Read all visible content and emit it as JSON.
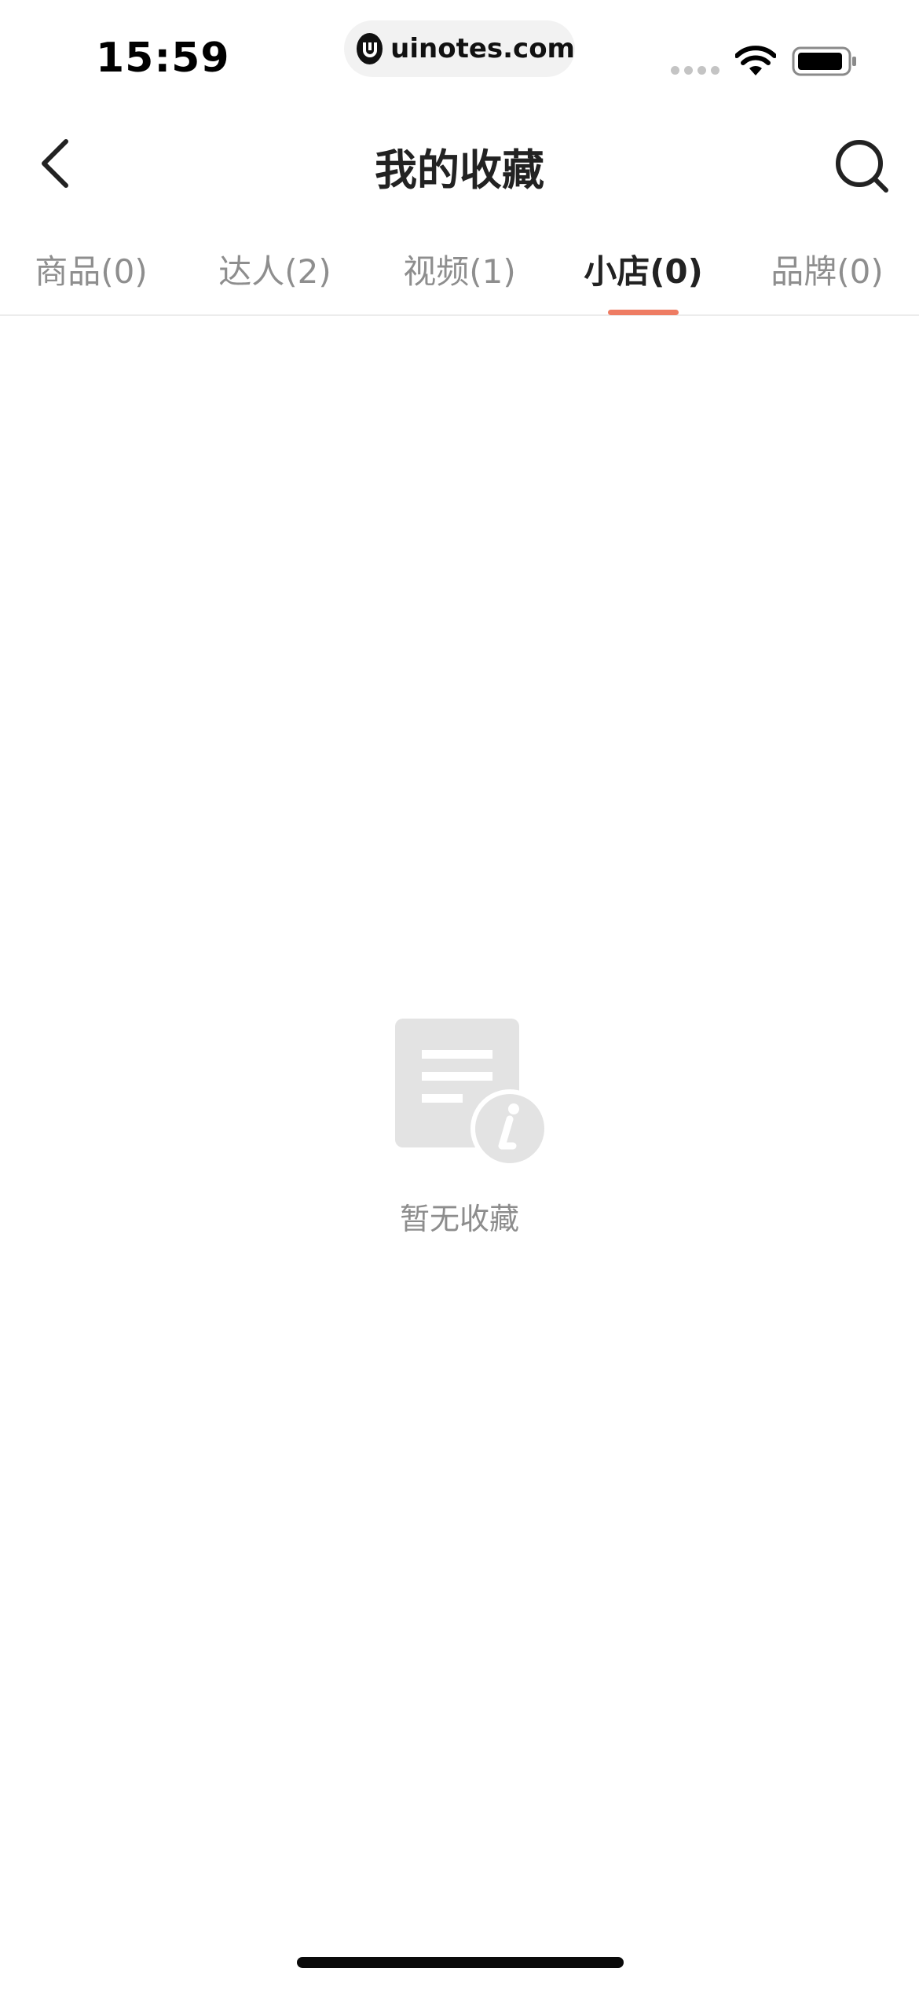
{
  "status_bar": {
    "time": "15:59",
    "url": "uinotes.com",
    "url_logo_icon": "uinotes-logo-icon",
    "wifi_icon": "wifi-icon",
    "battery_icon": "battery-icon"
  },
  "nav": {
    "title": "我的收藏",
    "back_icon": "chevron-left-icon",
    "search_icon": "search-icon"
  },
  "tabs": {
    "items": [
      {
        "label": "商品(0)",
        "active": false
      },
      {
        "label": "达人(2)",
        "active": false
      },
      {
        "label": "视频(1)",
        "active": false
      },
      {
        "label": "小店(0)",
        "active": true
      },
      {
        "label": "品牌(0)",
        "active": false
      }
    ],
    "indicator_color": "#ee7c63"
  },
  "empty_state": {
    "icon": "document-info-icon",
    "text": "暂无收藏"
  }
}
